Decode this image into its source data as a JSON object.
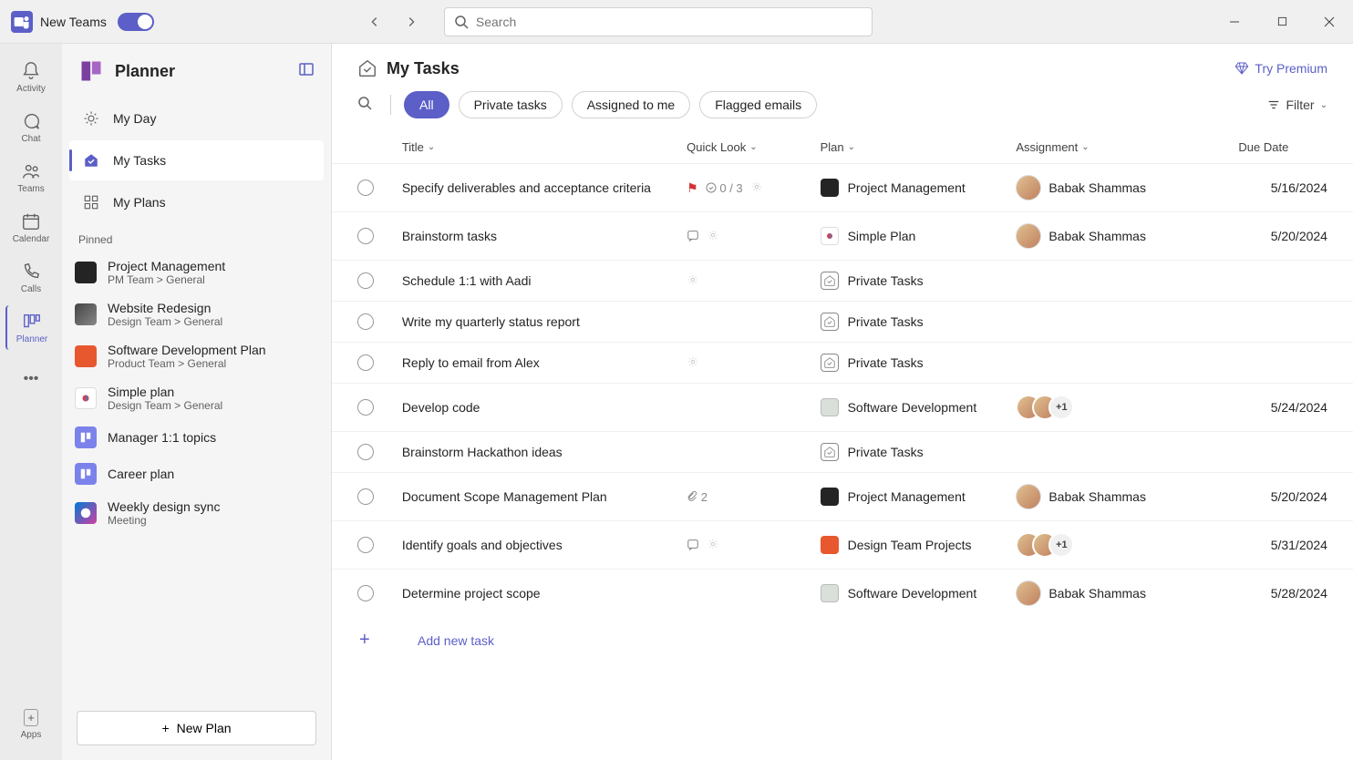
{
  "titlebar": {
    "app_label": "New Teams",
    "search_placeholder": "Search"
  },
  "rail": {
    "items": [
      {
        "label": "Activity",
        "icon": "bell"
      },
      {
        "label": "Chat",
        "icon": "chat"
      },
      {
        "label": "Teams",
        "icon": "people"
      },
      {
        "label": "Calendar",
        "icon": "calendar"
      },
      {
        "label": "Calls",
        "icon": "phone"
      },
      {
        "label": "Planner",
        "icon": "planner",
        "active": true
      }
    ],
    "apps_label": "Apps"
  },
  "sidebar": {
    "title": "Planner",
    "nav": [
      {
        "label": "My Day",
        "icon": "sun"
      },
      {
        "label": "My Tasks",
        "icon": "home-check",
        "active": true
      },
      {
        "label": "My Plans",
        "icon": "grid"
      }
    ],
    "pinned_label": "Pinned",
    "pinned": [
      {
        "name": "Project Management",
        "sub": "PM Team > General",
        "iconclass": "pm"
      },
      {
        "name": "Website Redesign",
        "sub": "Design Team > General",
        "iconclass": "wr"
      },
      {
        "name": "Software Development Plan",
        "sub": "Product Team > General",
        "iconclass": "sd"
      },
      {
        "name": "Simple plan",
        "sub": "Design Team > General",
        "iconclass": "sp"
      },
      {
        "name": "Manager 1:1 topics",
        "sub": "",
        "iconclass": "purple"
      },
      {
        "name": "Career plan",
        "sub": "",
        "iconclass": "purple"
      },
      {
        "name": "Weekly design sync",
        "sub": "Meeting",
        "iconclass": "wd"
      }
    ],
    "new_plan_label": "New Plan"
  },
  "content": {
    "title": "My Tasks",
    "try_premium": "Try Premium",
    "pills": [
      {
        "label": "All",
        "active": true
      },
      {
        "label": "Private tasks"
      },
      {
        "label": "Assigned to me"
      },
      {
        "label": "Flagged emails"
      }
    ],
    "filter_label": "Filter",
    "columns": {
      "title": "Title",
      "quick": "Quick Look",
      "plan": "Plan",
      "assign": "Assignment",
      "due": "Due Date"
    },
    "add_task_label": "Add new task",
    "tasks": [
      {
        "title": "Specify deliverables and acceptance criteria",
        "quick": {
          "flag": true,
          "progress": "0 / 3",
          "sun": true
        },
        "plan": {
          "name": "Project Management",
          "iconclass": "pm"
        },
        "assignees": [
          {
            "name": "Babak Shammas"
          }
        ],
        "due": "5/16/2024"
      },
      {
        "title": "Brainstorm tasks",
        "quick": {
          "note": true,
          "sun": true
        },
        "plan": {
          "name": "Simple Plan",
          "iconclass": "sp"
        },
        "assignees": [
          {
            "name": "Babak Shammas"
          }
        ],
        "due": "5/20/2024"
      },
      {
        "title": "Schedule 1:1 with Aadi",
        "quick": {
          "sun": true
        },
        "plan": {
          "name": "Private Tasks",
          "iconclass": "pt"
        },
        "assignees": [],
        "due": ""
      },
      {
        "title": "Write my quarterly status report",
        "quick": {},
        "plan": {
          "name": "Private Tasks",
          "iconclass": "pt"
        },
        "assignees": [],
        "due": ""
      },
      {
        "title": "Reply to email from Alex",
        "quick": {
          "sun": true
        },
        "plan": {
          "name": "Private Tasks",
          "iconclass": "pt"
        },
        "assignees": [],
        "due": ""
      },
      {
        "title": "Develop code",
        "quick": {},
        "plan": {
          "name": "Software Development",
          "iconclass": "sd"
        },
        "assignees": [
          {
            "name": ""
          },
          {
            "name": ""
          }
        ],
        "more": "+1",
        "due": "5/24/2024"
      },
      {
        "title": "Brainstorm Hackathon ideas",
        "quick": {},
        "plan": {
          "name": "Private Tasks",
          "iconclass": "pt"
        },
        "assignees": [],
        "due": ""
      },
      {
        "title": "Document Scope Management Plan",
        "quick": {
          "attach": "2"
        },
        "plan": {
          "name": "Project Management",
          "iconclass": "pm"
        },
        "assignees": [
          {
            "name": "Babak Shammas"
          }
        ],
        "due": "5/20/2024"
      },
      {
        "title": "Identify goals and objectives",
        "quick": {
          "note": true,
          "sun": true
        },
        "plan": {
          "name": "Design Team Projects",
          "iconclass": "dt"
        },
        "assignees": [
          {
            "name": ""
          },
          {
            "name": ""
          }
        ],
        "more": "+1",
        "due": "5/31/2024"
      },
      {
        "title": "Determine project scope",
        "quick": {},
        "plan": {
          "name": "Software Development",
          "iconclass": "sd"
        },
        "assignees": [
          {
            "name": "Babak Shammas"
          }
        ],
        "due": "5/28/2024"
      }
    ]
  }
}
